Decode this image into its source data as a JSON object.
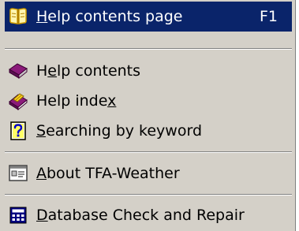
{
  "menu": {
    "items": [
      {
        "pre": "",
        "acc": "H",
        "post": "elp contents page",
        "shortcut": "F1",
        "icon": "help-book-open-icon",
        "selected": true
      },
      {
        "pre": "H",
        "acc": "e",
        "post": "lp contents",
        "icon": "help-book-closed-icon"
      },
      {
        "pre": "Help inde",
        "acc": "x",
        "post": "",
        "icon": "help-index-icon"
      },
      {
        "pre": "",
        "acc": "S",
        "post": "earching by keyword",
        "icon": "question-mark-icon"
      },
      {
        "pre": "",
        "acc": "A",
        "post": "bout TFA-Weather",
        "icon": "about-window-icon"
      },
      {
        "pre": "",
        "acc": "D",
        "post": "atabase Check and Repair",
        "icon": "calculator-icon"
      }
    ]
  },
  "colors": {
    "menu_background": "#d4d0c8",
    "highlight": "#0a246a",
    "highlight_text": "#ffffff"
  }
}
